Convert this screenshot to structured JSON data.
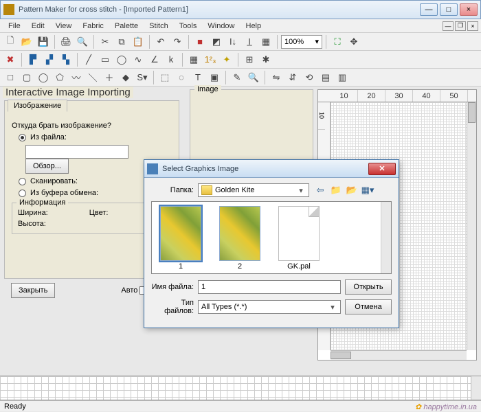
{
  "titlebar": {
    "title": "Pattern Maker for cross stitch - [Imported Pattern1]"
  },
  "menu": {
    "file": "File",
    "edit": "Edit",
    "view": "View",
    "fabric": "Fabric",
    "palette": "Palette",
    "stitch": "Stitch",
    "tools": "Tools",
    "window": "Window",
    "help": "Help"
  },
  "toolbar": {
    "zoom": "100%"
  },
  "heading": "Interactive Image Importing",
  "left": {
    "tab": "Изображение",
    "question": "Откуда брать изображение?",
    "from_file": "Из файла:",
    "browse": "Обзор...",
    "scan": "Сканировать:",
    "clipboard": "Из буфера обмена:",
    "info_legend": "Информация",
    "width": "Ширина:",
    "height": "Высота:",
    "color": "Цвет:"
  },
  "buttons": {
    "close": "Закрыть",
    "auto": "Авто"
  },
  "image_panel": {
    "legend": "Image"
  },
  "ruler": {
    "m10": "10",
    "m20": "20",
    "m30": "30",
    "m40": "40",
    "m50": "50",
    "v10": "10"
  },
  "dialog": {
    "title": "Select Graphics Image",
    "folder_label": "Папка:",
    "folder_value": "Golden Kite",
    "files": {
      "f1": "1",
      "f2": "2",
      "f3": "GK.pal"
    },
    "filename_label": "Имя файла:",
    "filename_value": "1",
    "filetype_label": "Тип файлов:",
    "filetype_value": "All Types (*.*)",
    "open": "Открыть",
    "cancel": "Отмена"
  },
  "status": {
    "ready": "Ready",
    "watermark": "happytime.in.ua"
  }
}
